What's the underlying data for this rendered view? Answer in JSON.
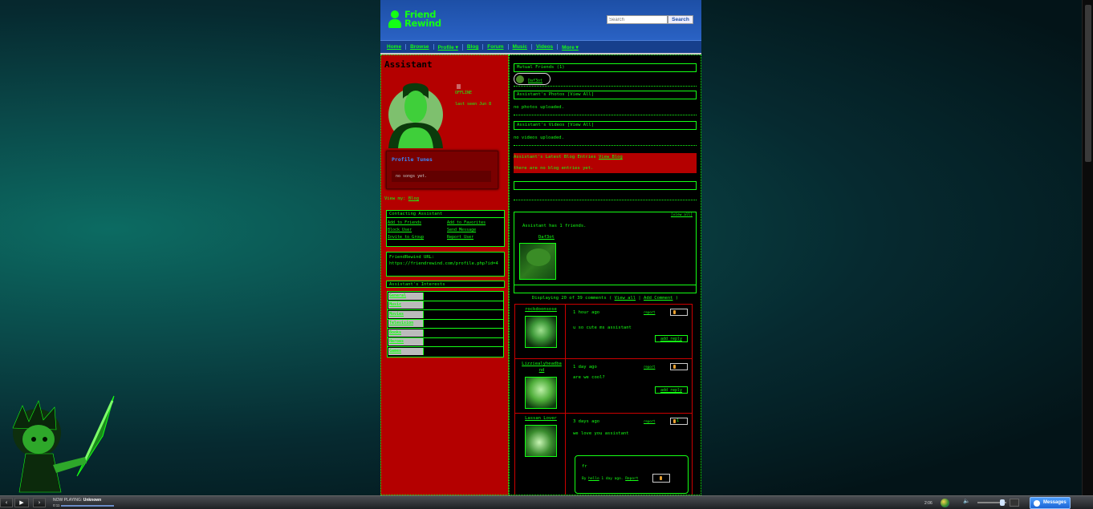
{
  "site": {
    "logo_line1": "Friend",
    "logo_line2": "Rewind",
    "search_placeholder": "Search",
    "search_button": "Search"
  },
  "nav": [
    "Home",
    "Browse",
    "Profile ▾",
    "Blog",
    "Forum",
    "Music",
    "Videos",
    "More ▾"
  ],
  "profile": {
    "name": "Assistant",
    "status": "OFFLINE",
    "last_seen": "last seen Jun 8",
    "tunes_title": "Profile Tunes",
    "tunes_empty": "no songs yet.",
    "view_my_label": "View my:",
    "view_my_link": "Blog",
    "contact_title": "Contacting Assistant",
    "contact_links": [
      "Add to Friends",
      "Add to Favorites",
      "Block User",
      "Send Message",
      "Invite to Group",
      "Report User"
    ],
    "url_label": "FriendRewind URL:",
    "url_value": "https://friendrewind.com/profile.php?id=4",
    "interests_title": "Assistant's Interests",
    "interests": [
      "General",
      "Music",
      "Movies",
      "Television",
      "Books",
      "Heroes",
      "Games"
    ]
  },
  "right": {
    "mutual_title": "Mutual Friends (1)",
    "mutual_name": "Daf3ot",
    "photos_title": "Assistant's Photos [View All]",
    "photos_empty": "no photos uploaded.",
    "videos_title": "Assistant's Videos [View All]",
    "videos_empty": "no videos uploaded.",
    "blog_title": "Assistant's Latest Blog Entries",
    "blog_link": "View Blog",
    "blog_empty": "there are no blog entries yet.",
    "view_all": "[view all]",
    "friends_count": "Assistant has 1 friends.",
    "friend_name": "Daf3ot",
    "displaying_prefix": "Displaying 20 of 39 comments (",
    "view_all_link": "View all",
    "sep": "|",
    "add_comment_link": "Add Comment",
    "displaying_suffix": ")"
  },
  "comments": [
    {
      "user": "rockdoonsose",
      "time": "1 hour ago",
      "text": "u so cute ms assistant",
      "report": "report",
      "likes": "",
      "reply": "add reply"
    },
    {
      "user": "Lizziealyheadband",
      "time": "1 day ago",
      "text": "are we cool?",
      "report": "report",
      "likes": "",
      "reply": "add reply"
    },
    {
      "user": "Lassan Lover",
      "time": "3 days ago",
      "text": "we love you assistant",
      "report": "report",
      "likes": "1",
      "reply": ""
    }
  ],
  "reply_box": {
    "text": "fr",
    "by": "By",
    "by_user": "hello",
    "age": "1 day ago.",
    "report": "Report"
  },
  "media": {
    "now_playing_label": "NOW PLAYING:",
    "now_playing_value": "Unknown",
    "elapsed": "0:11",
    "clock": "2:06",
    "messages_label": "Messages",
    "progress_fraction": 0.95
  },
  "colors": {
    "accent_green": "#14ff14",
    "panel_red": "#b40000",
    "header_blue": "#1d4fa6"
  }
}
